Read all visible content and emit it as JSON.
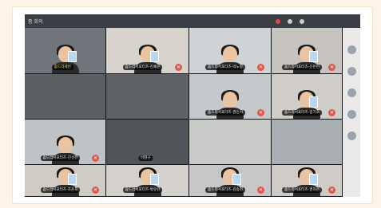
{
  "window": {
    "title": "줌 회의"
  },
  "participants": [
    {
      "name": "줌드리세빈",
      "active": true
    },
    {
      "name": "줌드리서포터즈-김채윤",
      "active": false
    },
    {
      "name": "줌드리서포터즈-박노랑",
      "active": false
    },
    {
      "name": "줌드리서포터즈-신은빈",
      "active": false
    },
    {
      "name": "",
      "active": false
    },
    {
      "name": "",
      "active": false
    },
    {
      "name": "줌드리서포터즈-권민서",
      "active": false
    },
    {
      "name": "줌드리서포터즈-김기호",
      "active": false
    },
    {
      "name": "줌드리서포터즈-진선한",
      "active": false
    },
    {
      "name": "이현구",
      "active": false
    },
    {
      "name": "",
      "active": false
    },
    {
      "name": "",
      "active": false
    },
    {
      "name": "줌드리서포터즈-조은희",
      "active": false
    },
    {
      "name": "줌드리서포터즈-박유란",
      "active": false
    },
    {
      "name": "줌드리서포터즈-김송현",
      "active": false
    },
    {
      "name": "줌드리서포터즈-권하은",
      "active": false
    },
    {
      "name": "",
      "active": false
    },
    {
      "name": "",
      "active": false
    },
    {
      "name": "",
      "active": false
    },
    {
      "name": "",
      "active": false
    }
  ],
  "icons": {
    "mic_muted": "mic-muted-icon",
    "recording": "record-icon",
    "sidebar": "participant-thumbnail-icon"
  },
  "colors": {
    "background": "#fdf3e7",
    "mic_muted": "#e2574c",
    "active_name": "#ffe06b"
  }
}
